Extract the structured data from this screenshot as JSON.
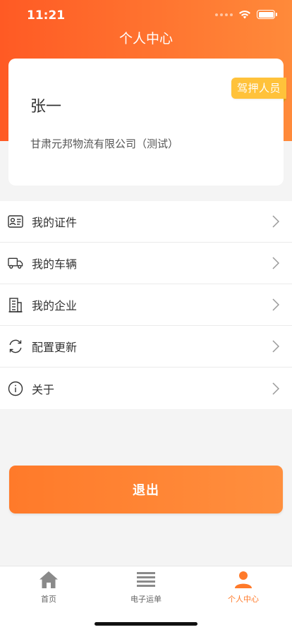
{
  "status_bar": {
    "time": "11:21"
  },
  "header": {
    "title": "个人中心"
  },
  "profile": {
    "name": "张一",
    "company": "甘肃元邦物流有限公司（测试）",
    "role_badge": "驾押人员"
  },
  "menu": [
    {
      "label": "我的证件",
      "icon": "id-card-icon"
    },
    {
      "label": "我的车辆",
      "icon": "truck-icon"
    },
    {
      "label": "我的企业",
      "icon": "building-icon"
    },
    {
      "label": "配置更新",
      "icon": "refresh-icon"
    },
    {
      "label": "关于",
      "icon": "info-icon"
    }
  ],
  "logout_label": "退出",
  "tabs": [
    {
      "label": "首页",
      "icon": "home-icon",
      "active": false
    },
    {
      "label": "电子运单",
      "icon": "list-icon",
      "active": false
    },
    {
      "label": "个人中心",
      "icon": "user-icon",
      "active": true
    }
  ],
  "colors": {
    "accent": "#ff7a2a",
    "badge": "#ffc23a",
    "inactive_icon": "#8a8a8a"
  }
}
